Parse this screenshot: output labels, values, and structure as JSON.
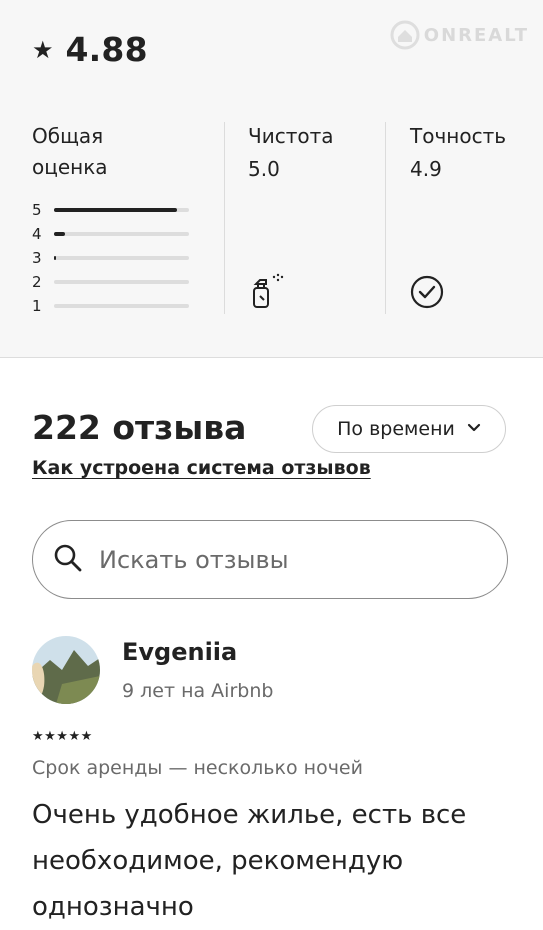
{
  "watermark": {
    "text": "ONREALT"
  },
  "rating": {
    "star": "★",
    "overall": "4.88"
  },
  "overall_breakdown": {
    "title": "Общая оценка",
    "rows": [
      {
        "label": "5",
        "fraction": 0.91
      },
      {
        "label": "4",
        "fraction": 0.08
      },
      {
        "label": "3",
        "fraction": 0.015
      },
      {
        "label": "2",
        "fraction": 0
      },
      {
        "label": "1",
        "fraction": 0
      }
    ]
  },
  "categories": [
    {
      "title": "Чистота",
      "value": "5.0",
      "icon": "spray-bottle-icon"
    },
    {
      "title": "Точность",
      "value": "4.9",
      "icon": "check-circle-icon"
    }
  ],
  "reviews": {
    "count_label": "222 отзыва",
    "sort_label": "По времени",
    "how_link": "Как устроена система отзывов",
    "search_placeholder": "Искать отзывы"
  },
  "review": {
    "name": "Evgeniia",
    "meta": "9 лет на Airbnb",
    "stars": "★★★★★",
    "stay": "Срок аренды — несколько ночей",
    "text": "Очень удобное жилье, есть все необходимое, рекомендую однозначно"
  }
}
